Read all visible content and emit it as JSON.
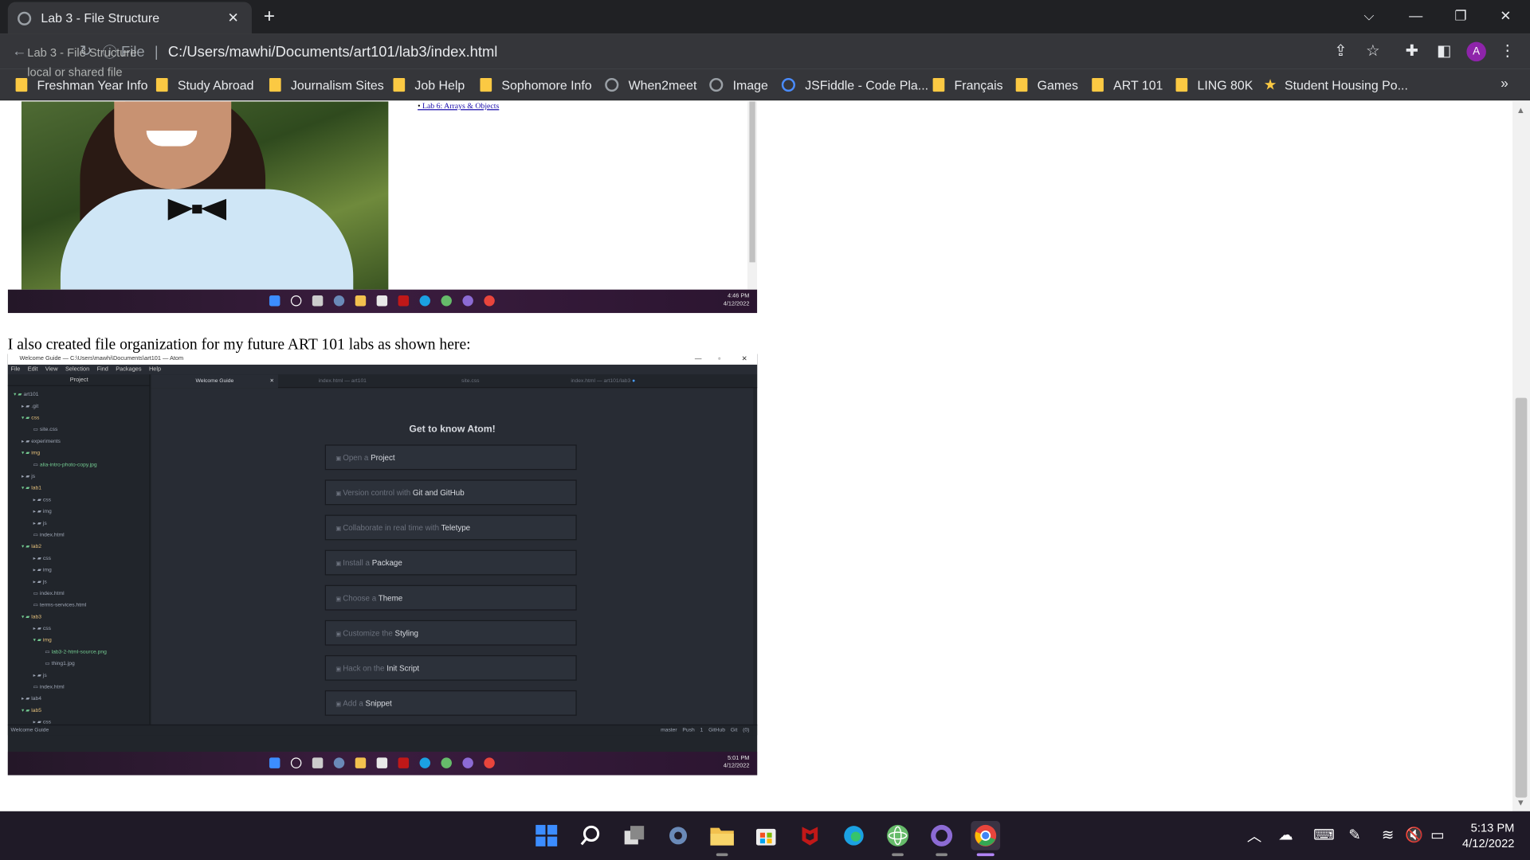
{
  "browser": {
    "tab_title": "Lab 3 - File Structure",
    "new_tab_icon": "plus-icon",
    "tooltip_title": "Lab 3 - File Structure",
    "tooltip_subtitle": "local or shared file",
    "address_scheme": "File",
    "address_url_prefix": "C:/Users/maw",
    "address_url_rest": "hi/Documents/art101/lab3/index.html",
    "profile_initial": "A"
  },
  "bookmarks": [
    {
      "label": "Freshman Year Info",
      "icon": "folder-icon"
    },
    {
      "label": "Study Abroad",
      "icon": "folder-icon"
    },
    {
      "label": "Journalism Sites",
      "icon": "folder-icon"
    },
    {
      "label": "Job Help",
      "icon": "folder-icon"
    },
    {
      "label": "Sophomore Info",
      "icon": "folder-icon"
    },
    {
      "label": "When2meet",
      "icon": "clock-icon"
    },
    {
      "label": "Image",
      "icon": "globe-icon"
    },
    {
      "label": "JSFiddle - Code Pla...",
      "icon": "jsfiddle-icon"
    },
    {
      "label": "Français",
      "icon": "folder-icon"
    },
    {
      "label": "Games",
      "icon": "folder-icon"
    },
    {
      "label": "ART 101",
      "icon": "folder-icon"
    },
    {
      "label": "LING 80K",
      "icon": "folder-icon"
    },
    {
      "label": "Student Housing Po...",
      "icon": "star-icon"
    }
  ],
  "page": {
    "shot1_link": "Lab 6: Arrays & Objects",
    "shot1_time": "4:46 PM",
    "shot1_date": "4/12/2022",
    "caption": "I also created file organization for my future ART 101 labs as shown here:"
  },
  "atom": {
    "window_title": "Welcome Guide — C:\\Users\\mawhi\\Documents\\art101 — Atom",
    "menu": [
      "File",
      "Edit",
      "View",
      "Selection",
      "Find",
      "Packages",
      "Help"
    ],
    "tree_header": "Project",
    "tree": [
      {
        "label": "art101",
        "kind": "root"
      },
      {
        "label": ".git",
        "kind": "dir"
      },
      {
        "label": "css",
        "kind": "dirg"
      },
      {
        "label": "site.css",
        "kind": "file"
      },
      {
        "label": "experiments",
        "kind": "dir"
      },
      {
        "label": "img",
        "kind": "dirg"
      },
      {
        "label": "alia-intro-photo-copy.jpg",
        "kind": "fileg"
      },
      {
        "label": "js",
        "kind": "dir"
      },
      {
        "label": "lab1",
        "kind": "dirg"
      },
      {
        "label": "css",
        "kind": "dir"
      },
      {
        "label": "img",
        "kind": "dir"
      },
      {
        "label": "js",
        "kind": "dir"
      },
      {
        "label": "index.html",
        "kind": "file"
      },
      {
        "label": "lab2",
        "kind": "dirg"
      },
      {
        "label": "css",
        "kind": "dir"
      },
      {
        "label": "img",
        "kind": "dir"
      },
      {
        "label": "js",
        "kind": "dir"
      },
      {
        "label": "index.html",
        "kind": "file"
      },
      {
        "label": "terms-services.html",
        "kind": "file"
      },
      {
        "label": "lab3",
        "kind": "dirg"
      },
      {
        "label": "css",
        "kind": "dir"
      },
      {
        "label": "img",
        "kind": "dirg"
      },
      {
        "label": "lab3-2-html-source.png",
        "kind": "fileg"
      },
      {
        "label": "thing1.jpg",
        "kind": "file"
      },
      {
        "label": "js",
        "kind": "dir"
      },
      {
        "label": "index.html",
        "kind": "file"
      },
      {
        "label": "lab4",
        "kind": "dir"
      },
      {
        "label": "lab5",
        "kind": "dirg"
      },
      {
        "label": "css",
        "kind": "dir"
      }
    ],
    "tabs": [
      "Welcome Guide",
      "index.html — art101",
      "site.css",
      "index.html — art101/lab3"
    ],
    "heading": "Get to know Atom!",
    "guides": [
      {
        "pre": "Open a ",
        "strong": "Project"
      },
      {
        "pre": "Version control with ",
        "strong": "Git and GitHub"
      },
      {
        "pre": "Collaborate in real time with ",
        "strong": "Teletype"
      },
      {
        "pre": "Install a ",
        "strong": "Package"
      },
      {
        "pre": "Choose a ",
        "strong": "Theme"
      },
      {
        "pre": "Customize the ",
        "strong": "Styling"
      },
      {
        "pre": "Hack on the ",
        "strong": "Init Script"
      },
      {
        "pre": "Add a ",
        "strong": "Snippet"
      }
    ],
    "status_left": "Welcome Guide",
    "status_right": "master   Push 1   GitHub   Git (0)",
    "shot2_time": "5:01 PM",
    "shot2_date": "4/12/2022"
  },
  "taskbar": {
    "apps": [
      "windows-start-icon",
      "search-icon",
      "task-view-icon",
      "settings-icon",
      "file-explorer-icon",
      "microsoft-store-icon",
      "mcafee-icon",
      "edge-icon",
      "atom-icon",
      "github-desktop-icon",
      "chrome-icon"
    ],
    "time": "5:13 PM",
    "date": "4/12/2022"
  },
  "colors": {
    "accent_purple": "#8e24aa",
    "folder_yellow": "#fbc943",
    "atom_green": "#73c990"
  }
}
